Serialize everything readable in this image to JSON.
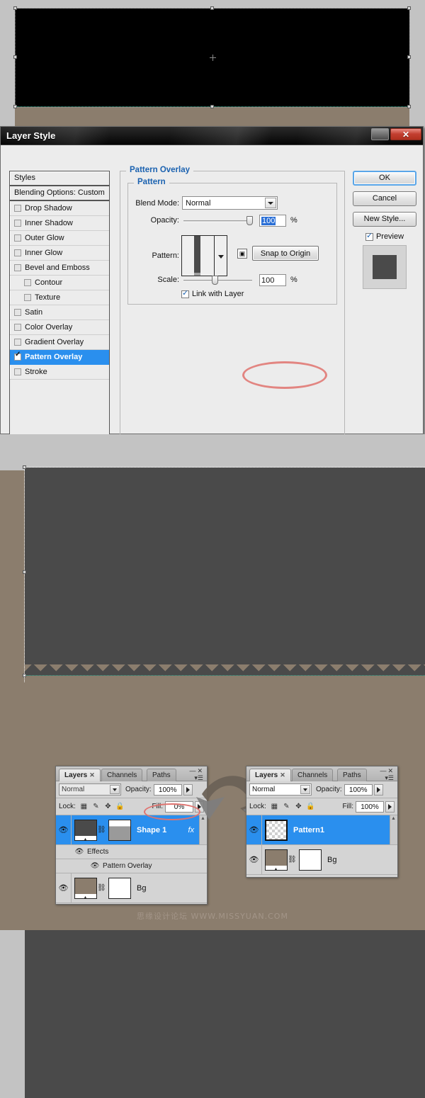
{
  "dialog": {
    "title": "Layer Style",
    "window_buttons": {
      "minimize": "—",
      "close": "✕"
    },
    "styles_panel": {
      "header": "Styles",
      "blending_options": "Blending Options: Custom",
      "items": [
        {
          "label": "Drop Shadow",
          "checked": false,
          "indent": false,
          "selected": false
        },
        {
          "label": "Inner Shadow",
          "checked": false,
          "indent": false,
          "selected": false
        },
        {
          "label": "Outer Glow",
          "checked": false,
          "indent": false,
          "selected": false
        },
        {
          "label": "Inner Glow",
          "checked": false,
          "indent": false,
          "selected": false
        },
        {
          "label": "Bevel and Emboss",
          "checked": false,
          "indent": false,
          "selected": false
        },
        {
          "label": "Contour",
          "checked": false,
          "indent": true,
          "selected": false
        },
        {
          "label": "Texture",
          "checked": false,
          "indent": true,
          "selected": false
        },
        {
          "label": "Satin",
          "checked": false,
          "indent": false,
          "selected": false
        },
        {
          "label": "Color Overlay",
          "checked": false,
          "indent": false,
          "selected": false
        },
        {
          "label": "Gradient Overlay",
          "checked": false,
          "indent": false,
          "selected": false
        },
        {
          "label": "Pattern Overlay",
          "checked": true,
          "indent": false,
          "selected": true
        },
        {
          "label": "Stroke",
          "checked": false,
          "indent": false,
          "selected": false
        }
      ]
    },
    "pattern_overlay": {
      "group_title": "Pattern Overlay",
      "sub_group_title": "Pattern",
      "blend_mode_label": "Blend Mode:",
      "blend_mode_value": "Normal",
      "opacity_label": "Opacity:",
      "opacity_value": "100",
      "opacity_unit": "%",
      "pattern_label": "Pattern:",
      "snap_icon_glyph": "▣",
      "snap_button": "Snap to Origin",
      "scale_label": "Scale:",
      "scale_value": "100",
      "scale_unit": "%",
      "link_with_layer": "Link with Layer",
      "link_checked": true
    },
    "buttons": {
      "ok": "OK",
      "cancel": "Cancel",
      "new_style": "New Style...",
      "preview": "Preview",
      "preview_checked": true
    }
  },
  "layers_left": {
    "tabs": [
      {
        "label": "Layers",
        "active": true,
        "close": "✕"
      },
      {
        "label": "Channels",
        "active": false,
        "close": ""
      },
      {
        "label": "Paths",
        "active": false,
        "close": ""
      }
    ],
    "blend_mode": "Normal",
    "opacity_label": "Opacity:",
    "opacity_value": "100%",
    "lock_label": "Lock:",
    "lock_icons": [
      "transparency-lock",
      "brush-lock",
      "move-lock",
      "all-lock"
    ],
    "fill_label": "Fill:",
    "fill_value": "0%",
    "rows": [
      {
        "type": "layer",
        "name": "Shape 1",
        "selected": true,
        "fx": "fx",
        "eye": "👁"
      },
      {
        "type": "sub",
        "level": 1,
        "name": "Effects",
        "eye": "👁"
      },
      {
        "type": "sub",
        "level": 2,
        "name": "Pattern Overlay",
        "eye": "👁"
      },
      {
        "type": "layer",
        "name": "Bg",
        "selected": false,
        "fx": "",
        "eye": "👁"
      }
    ]
  },
  "layers_right": {
    "tabs": [
      {
        "label": "Layers",
        "active": true,
        "close": "✕"
      },
      {
        "label": "Channels",
        "active": false,
        "close": ""
      },
      {
        "label": "Paths",
        "active": false,
        "close": ""
      }
    ],
    "blend_mode": "Normal",
    "opacity_label": "Opacity:",
    "opacity_value": "100%",
    "lock_label": "Lock:",
    "fill_label": "Fill:",
    "fill_value": "100%",
    "rows": [
      {
        "type": "layer",
        "name": "Pattern1",
        "selected": true,
        "eye": "👁"
      },
      {
        "type": "layer",
        "name": "Bg",
        "selected": false,
        "eye": "👁"
      }
    ]
  },
  "watermark": "思缘设计论坛 WWW.MISSYUAN.COM",
  "colors": {
    "accent_blue": "#2a8fee",
    "group_label_blue": "#1b62b0",
    "annotation_red": "#e0736f",
    "canvas_brown": "#8b7d6d",
    "canvas_dark": "#4a4a4a",
    "app_gray": "#c3c3c3"
  }
}
